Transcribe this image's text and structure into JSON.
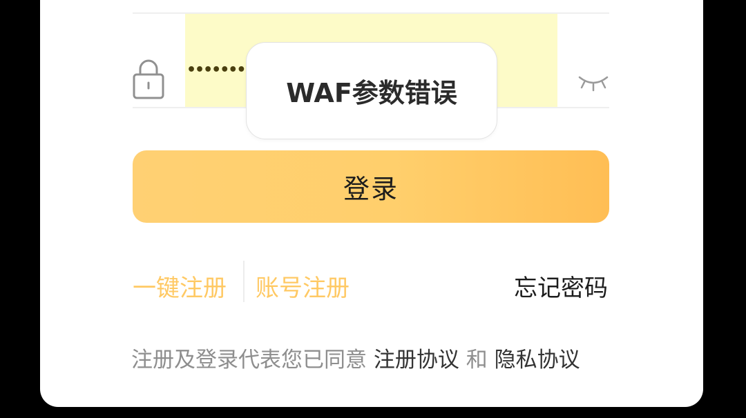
{
  "password_field": {
    "masked_value": "••••••••••",
    "lock_icon": "lock-icon",
    "visibility_icon": "eye-closed-icon"
  },
  "login_button": {
    "label": "登录"
  },
  "links": {
    "quick_register": "一键注册",
    "account_register": "账号注册",
    "forgot_password": "忘记密码"
  },
  "agreement": {
    "prefix": "注册及登录代表您已同意",
    "register_agreement": "注册协议",
    "and": "和",
    "privacy_agreement": "隐私协议"
  },
  "toast": {
    "message": "WAF参数错误"
  },
  "colors": {
    "accent": "#ffc964",
    "button_gradient_start": "#ffd073",
    "button_gradient_end": "#ffbe54",
    "password_highlight": "#fdfbc8",
    "background": "#000000",
    "card": "#ffffff"
  }
}
